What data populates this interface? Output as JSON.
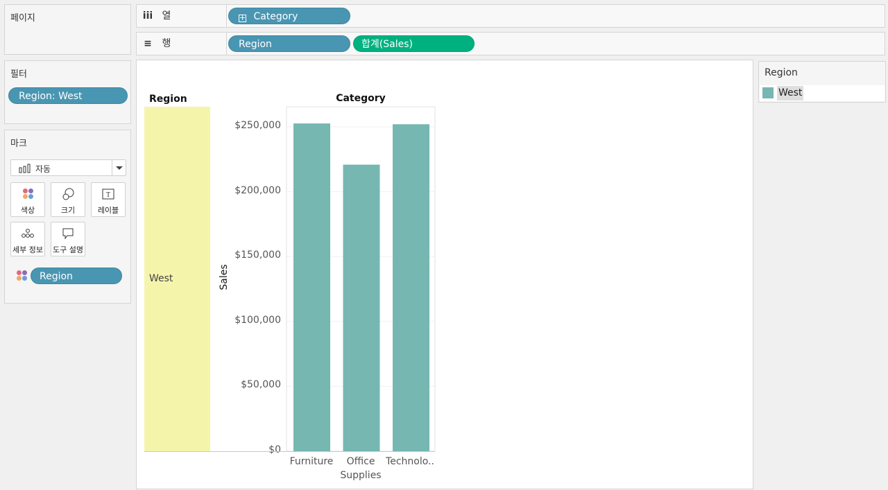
{
  "left_panel": {
    "pages_title": "페이지",
    "filters_title": "필터",
    "filter_pill": "Region: West",
    "marks_title": "마크",
    "mark_type": "자동",
    "mark_buttons": {
      "color": "색상",
      "size": "크기",
      "label": "레이블",
      "detail": "세부 정보",
      "tooltip": "도구 설명"
    },
    "color_pill": "Region"
  },
  "shelves": {
    "columns_label": "열",
    "rows_label": "행",
    "columns_pills": [
      "Category"
    ],
    "rows_pills": [
      "Region",
      "합계(Sales)"
    ]
  },
  "view": {
    "region_header": "Region",
    "category_header": "Category",
    "row_value": "West",
    "y_axis_title": "Sales",
    "y_ticks": [
      "$250,000",
      "$200,000",
      "$150,000",
      "$100,000",
      "$50,000",
      "$0"
    ],
    "categories": [
      {
        "line1": "Furniture",
        "line2": ""
      },
      {
        "line1": "Office",
        "line2": "Supplies"
      },
      {
        "line1": "Technolo..",
        "line2": ""
      }
    ]
  },
  "legend": {
    "title": "Region",
    "items": [
      {
        "label": "West",
        "color": "#76b7b2"
      }
    ]
  },
  "colors": {
    "bar": "#76b7b2",
    "row_header_fill": "#f4f5ab",
    "pill_blue": "#4996b2",
    "pill_green": "#00b180"
  },
  "chart_data": {
    "type": "bar",
    "categories": [
      "Furniture",
      "Office Supplies",
      "Technology"
    ],
    "series": [
      {
        "name": "West",
        "values": [
          252613,
          220853,
          251992
        ]
      }
    ],
    "xlabel": "Category",
    "ylabel": "Sales",
    "ylim": [
      0,
      250000
    ]
  }
}
